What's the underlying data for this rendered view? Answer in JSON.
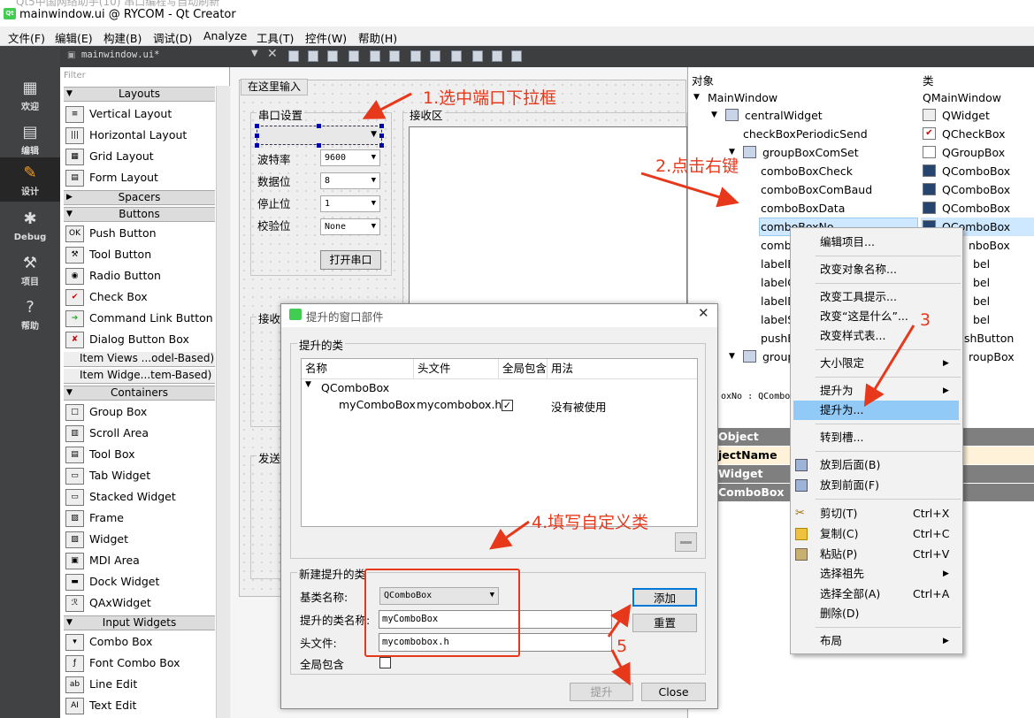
{
  "window": {
    "ghost_title": "Qt5中国网络助手(10) 串口编程写自动刷新",
    "title": "mainwindow.ui @ RYCOM - Qt Creator"
  },
  "menubar": [
    "文件(F)",
    "编辑(E)",
    "构建(B)",
    "调试(D)",
    "Analyze",
    "工具(T)",
    "控件(W)",
    "帮助(H)"
  ],
  "sidebar": [
    {
      "label": "欢迎",
      "icon": "grid-icon"
    },
    {
      "label": "编辑",
      "icon": "document-icon"
    },
    {
      "label": "设计",
      "icon": "pencil-icon"
    },
    {
      "label": "Debug",
      "icon": "bug-icon"
    },
    {
      "label": "项目",
      "icon": "wrench-icon"
    },
    {
      "label": "帮助",
      "icon": "help-icon"
    }
  ],
  "toolbar": {
    "file_tab": "mainwindow.ui*"
  },
  "widgetbox": {
    "filter_placeholder": "Filter",
    "categories": {
      "layouts": "Layouts",
      "spacers": "Spacers",
      "buttons": "Buttons",
      "item_views": "Item Views ...odel-Based)",
      "item_widgets": "Item Widge...tem-Based)",
      "containers": "Containers",
      "input_widgets": "Input Widgets"
    },
    "layouts": [
      "Vertical Layout",
      "Horizontal Layout",
      "Grid Layout",
      "Form Layout"
    ],
    "buttons": [
      "Push Button",
      "Tool Button",
      "Radio Button",
      "Check Box",
      "Command Link Button",
      "Dialog Button Box"
    ],
    "containers": [
      "Group Box",
      "Scroll Area",
      "Tool Box",
      "Tab Widget",
      "Stacked Widget",
      "Frame",
      "Widget",
      "MDI Area",
      "Dock Widget",
      "QAxWidget"
    ],
    "inputs": [
      "Combo Box",
      "Font Combo Box",
      "Line Edit",
      "Text Edit"
    ]
  },
  "form": {
    "menu_placeholder": "在这里输入",
    "serial_group": "串口设置",
    "recv_group": "接收区",
    "labels": [
      "波特率",
      "数据位",
      "停止位",
      "校验位"
    ],
    "values": [
      "9600",
      "8",
      "1",
      "None"
    ],
    "open_button": "打开串口",
    "left_label_2": "接收",
    "left_label_3": "发送"
  },
  "objinsp": {
    "col_object": "对象",
    "col_class": "类",
    "rows": [
      {
        "name": "MainWindow",
        "cls": "QMainWindow"
      },
      {
        "name": "centralWidget",
        "cls": "QWidget"
      },
      {
        "name": "checkBoxPeriodicSend",
        "cls": "QCheckBox"
      },
      {
        "name": "groupBoxComSet",
        "cls": "QGroupBox"
      },
      {
        "name": "comboBoxCheck",
        "cls": "QComboBox"
      },
      {
        "name": "comboBoxComBaud",
        "cls": "QComboBox"
      },
      {
        "name": "comboBoxData",
        "cls": "QComboBox"
      },
      {
        "name": "comboBoxNo",
        "cls": "QComboBox"
      },
      {
        "name": "comb",
        "cls": "nboBox"
      },
      {
        "name": "labelE",
        "cls": "bel"
      },
      {
        "name": "labelC",
        "cls": "bel"
      },
      {
        "name": "labelD",
        "cls": "bel"
      },
      {
        "name": "labelS",
        "cls": "bel"
      },
      {
        "name": "pushB",
        "cls": "shButton"
      },
      {
        "name": "group",
        "cls": "roupBox"
      }
    ]
  },
  "propedit": {
    "filter_text": "oxNo : QCombo",
    "headers": [
      "Object",
      "Widget",
      "ComboBox"
    ],
    "row": "jectName"
  },
  "contextmenu": [
    {
      "label": "编辑项目...",
      "shortcut": ""
    },
    {
      "label": "改变对象名称...",
      "shortcut": ""
    },
    {
      "label": "改变工具提示...",
      "shortcut": ""
    },
    {
      "label": "改变“这是什么”...",
      "shortcut": ""
    },
    {
      "label": "改变样式表...",
      "shortcut": ""
    },
    {
      "label": "大小限定",
      "shortcut": ""
    },
    {
      "label": "提升为",
      "shortcut": ""
    },
    {
      "label": "提升为...",
      "shortcut": ""
    },
    {
      "label": "转到槽...",
      "shortcut": ""
    },
    {
      "label": "放到后面(B)",
      "shortcut": ""
    },
    {
      "label": "放到前面(F)",
      "shortcut": ""
    },
    {
      "label": "剪切(T)",
      "shortcut": "Ctrl+X"
    },
    {
      "label": "复制(C)",
      "shortcut": "Ctrl+C"
    },
    {
      "label": "粘贴(P)",
      "shortcut": "Ctrl+V"
    },
    {
      "label": "选择祖先",
      "shortcut": ""
    },
    {
      "label": "选择全部(A)",
      "shortcut": "Ctrl+A"
    },
    {
      "label": "删除(D)",
      "shortcut": ""
    },
    {
      "label": "布局",
      "shortcut": ""
    }
  ],
  "dialog": {
    "title": "提升的窗口部件",
    "group1": "提升的类",
    "columns": [
      "名称",
      "头文件",
      "全局包含",
      "用法"
    ],
    "parent_class": "QComboBox",
    "child_name": "myComboBox",
    "child_header": "mycombobox.h",
    "child_usage": "没有被使用",
    "group2": "新建提升的类",
    "base_label": "基类名称:",
    "base_value": "QComboBox",
    "class_label": "提升的类名称:",
    "class_value": "myComboBox",
    "header_label": "头文件:",
    "header_value": "mycombobox.h",
    "global_label": "全局包含",
    "add_button": "添加",
    "reset_button": "重置",
    "promote_button": "提升",
    "close_button": "Close"
  },
  "annotations": {
    "step1": "1.选中端口下拉框",
    "step2": "2.点击右键",
    "step3": "3",
    "step4": "4.填写自定义类",
    "step5": "5",
    "color": "#e8381b"
  }
}
